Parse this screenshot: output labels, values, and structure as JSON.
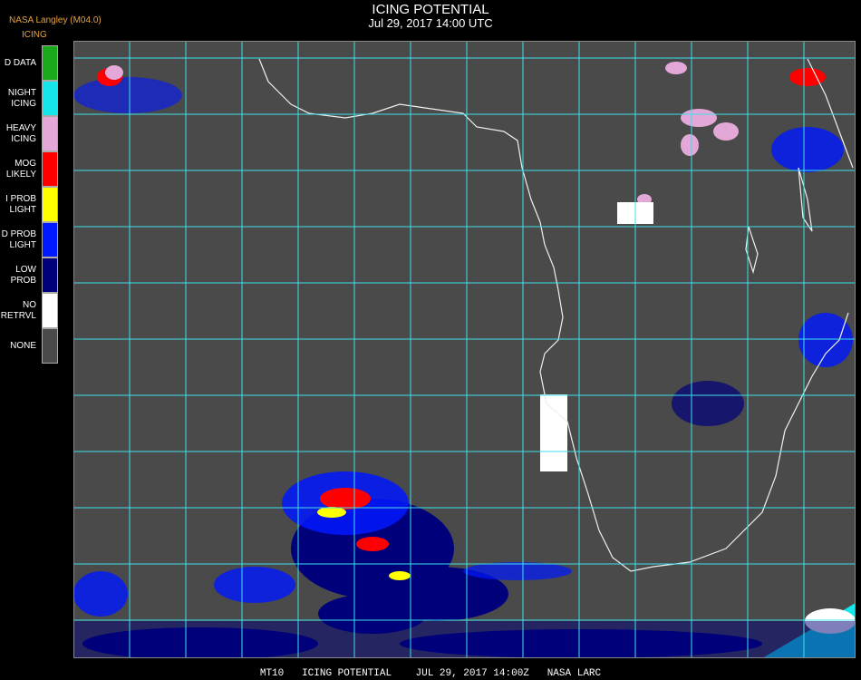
{
  "header": {
    "org": "NASA Langley (M04.0)",
    "unit": "ICING",
    "title": "ICING POTENTIAL",
    "subtitle": "Jul 29, 2017 14:00 UTC"
  },
  "legend": [
    {
      "label": "D DATA",
      "color": "#1aa91a"
    },
    {
      "label": "NIGHT\nICING",
      "color": "#15e6ea"
    },
    {
      "label": "HEAVY\nICING",
      "color": "#e3a8d8"
    },
    {
      "label": "MOG\nLIKELY",
      "color": "#ff0000"
    },
    {
      "label": "I PROB\nLIGHT",
      "color": "#ffff00"
    },
    {
      "label": "D PROB\nLIGHT",
      "color": "#0018ff"
    },
    {
      "label": "LOW\nPROB",
      "color": "#00007a"
    },
    {
      "label": "NO\nRETRVL",
      "color": "#ffffff"
    },
    {
      "label": "NONE",
      "color": "#4a4a4a"
    }
  ],
  "map": {
    "background": "#4a4a4a",
    "grid_color": "#3ee0e8",
    "coast_color": "#f0f0f0",
    "grid_label_color": "#b01e1e"
  },
  "footer": "MT10   ICING POTENTIAL    JUL 29, 2017 14:00Z   NASA LARC"
}
